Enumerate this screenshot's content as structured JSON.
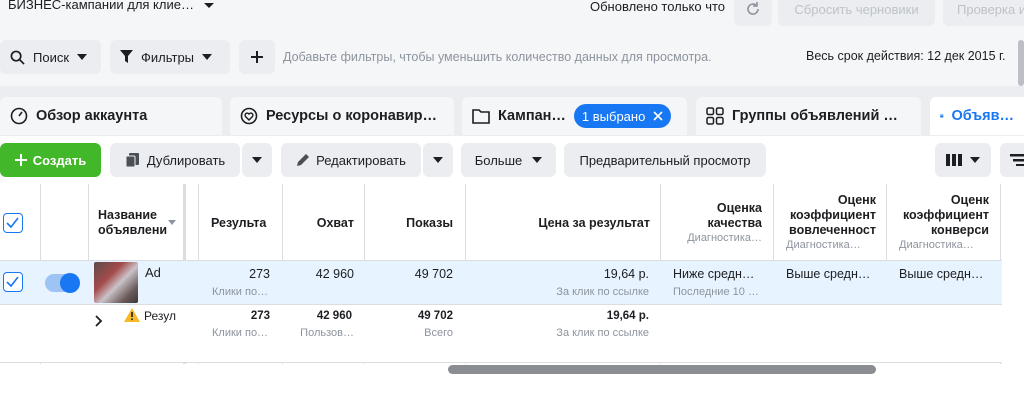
{
  "topbar": {
    "account": "БИЗНЕС-кампании для клие…",
    "updated": "Обновлено только что",
    "reset_drafts": "Сбросить черновики",
    "review": "Проверка и"
  },
  "filterbar": {
    "search": "Поиск",
    "filters": "Фильтры",
    "hint": "Добавьте фильтры, чтобы уменьшить количество данных для просмотра.",
    "period": "Весь срок действия: 12 дек 2015 г."
  },
  "tabs": [
    {
      "label": "Обзор аккаунта"
    },
    {
      "label": "Ресурсы о коронавир…"
    },
    {
      "label": "Кампан…",
      "pill": "1 выбрано"
    },
    {
      "label": "Группы объявлений …"
    },
    {
      "label": "Объяв…"
    }
  ],
  "toolbar": {
    "create": "Создать",
    "duplicate": "Дублировать",
    "edit": "Редактировать",
    "more": "Больше",
    "preview": "Предварительный просмотр"
  },
  "table": {
    "headers": {
      "name": [
        "Название",
        "объявлени"
      ],
      "results": "Результа",
      "reach": "Охват",
      "impressions": "Показы",
      "cost": "Цена за результат",
      "quality": [
        "Оценка",
        "качества"
      ],
      "quality_sub": "Диагностика…",
      "engagement": [
        "Оценк",
        "коэффициент",
        "вовлеченност"
      ],
      "engagement_sub": "Диагностика…",
      "conversion": [
        "Оценк",
        "коэффициент",
        "конверси"
      ],
      "conversion_sub": "Диагностика…"
    },
    "row": {
      "name": "Ad",
      "results": "273",
      "results_sub": "Клики по…",
      "reach": "42 960",
      "impressions": "49 702",
      "cost": "19,64 р.",
      "cost_sub": "За клик по ссылке",
      "quality": "Ниже средн…",
      "quality_sub": "Последние 10 …",
      "engagement": "Выше средн…",
      "conversion": "Выше средн…"
    },
    "summary": {
      "label": "Резул",
      "results": "273",
      "results_sub": "Клики по…",
      "reach": "42 960",
      "reach_sub": "Пользов…",
      "impressions": "49 702",
      "impressions_sub": "Всего",
      "cost": "19,64 р.",
      "cost_sub": "За клик по ссылке"
    }
  }
}
